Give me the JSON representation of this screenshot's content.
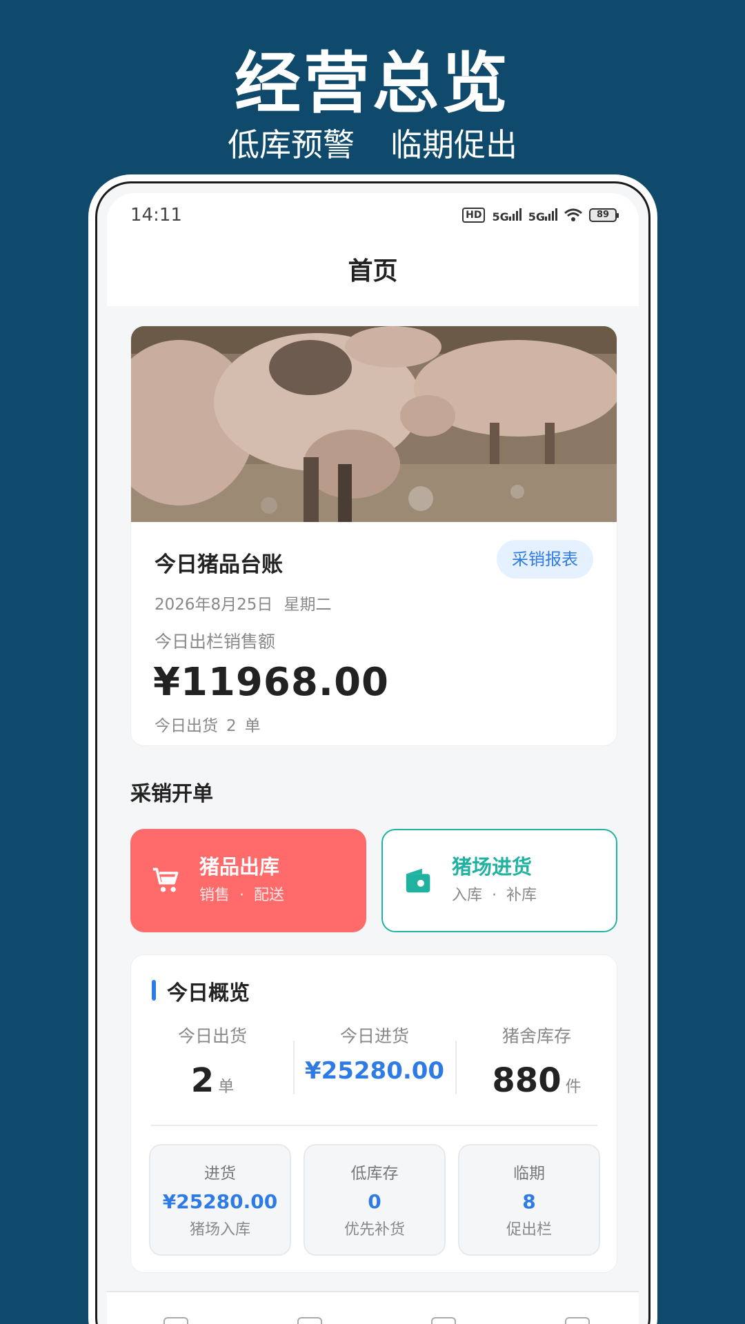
{
  "promo": {
    "title": "经营总览",
    "subtitle_left": "低库预警",
    "subtitle_right": "临期促出"
  },
  "status_bar": {
    "time": "14:11",
    "hd_label": "HD",
    "signal_1": "5G",
    "signal_2": "5G",
    "battery": "89"
  },
  "nav": {
    "title": "首页"
  },
  "ledger": {
    "title": "今日猪品台账",
    "report_button": "采销报表",
    "date": "2026年8月25日",
    "weekday": "星期二",
    "sales_label": "今日出栏销售额",
    "sales_amount": "¥11968.00",
    "shipped_prefix": "今日出货",
    "shipped_count": "2",
    "shipped_unit": "单"
  },
  "order_section": {
    "title": "采销开单"
  },
  "actions": {
    "outbound": {
      "title": "猪品出库",
      "sub_a": "销售",
      "sep": "·",
      "sub_b": "配送",
      "icon": "cart-icon",
      "color": "#ff6b6b"
    },
    "inbound": {
      "title": "猪场进货",
      "sub_a": "入库",
      "sep": "·",
      "sub_b": "补库",
      "icon": "wallet-icon",
      "color": "#20b2a0"
    }
  },
  "overview": {
    "title": "今日概览",
    "stats": [
      {
        "label": "今日出货",
        "value": "2",
        "unit": "单"
      },
      {
        "label": "今日进货",
        "value": "¥25280.00",
        "unit": ""
      },
      {
        "label": "猪舍库存",
        "value": "880",
        "unit": "件"
      }
    ],
    "mini": [
      {
        "label": "进货",
        "value": "¥25280.00",
        "sub": "猪场入库"
      },
      {
        "label": "低库存",
        "value": "0",
        "sub": "优先补货"
      },
      {
        "label": "临期",
        "value": "8",
        "sub": "促出栏"
      }
    ]
  },
  "colors": {
    "accent": "#2f7be6",
    "background": "#0f4a6c"
  }
}
